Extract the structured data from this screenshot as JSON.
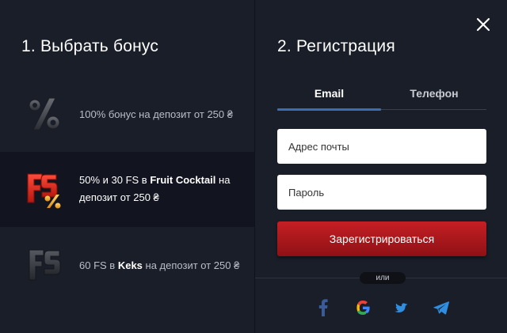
{
  "left": {
    "title": "1. Выбрать бонус",
    "bonuses": [
      {
        "icon": "percent-icon",
        "text": "100% бонус на депозит от 250 ₴"
      },
      {
        "icon": "fs-percent-icon",
        "text_pre": "50% и 30 FS в ",
        "bold_game": "Fruit Cocktail",
        "text_post": " на депозит от 250 ₴",
        "active": true
      },
      {
        "icon": "fs-icon",
        "text_pre": "60 FS в ",
        "bold_game": "Keks",
        "text_post": " на депозит от 250 ₴"
      }
    ]
  },
  "right": {
    "title": "2. Регистрация",
    "tabs": [
      {
        "label": "Email",
        "active": true
      },
      {
        "label": "Телефон",
        "active": false
      }
    ],
    "email_placeholder": "Адрес почты",
    "password_placeholder": "Пароль",
    "submit_label": "Зарегистрироваться",
    "or_label": "или",
    "social": [
      "facebook-icon",
      "google-icon",
      "twitter-icon",
      "telegram-icon"
    ]
  },
  "colors": {
    "panel_bg": "#1a1e29",
    "active_row_bg": "#121520",
    "tab_accent": "#3a6db4",
    "submit_red": "#c51f24"
  }
}
